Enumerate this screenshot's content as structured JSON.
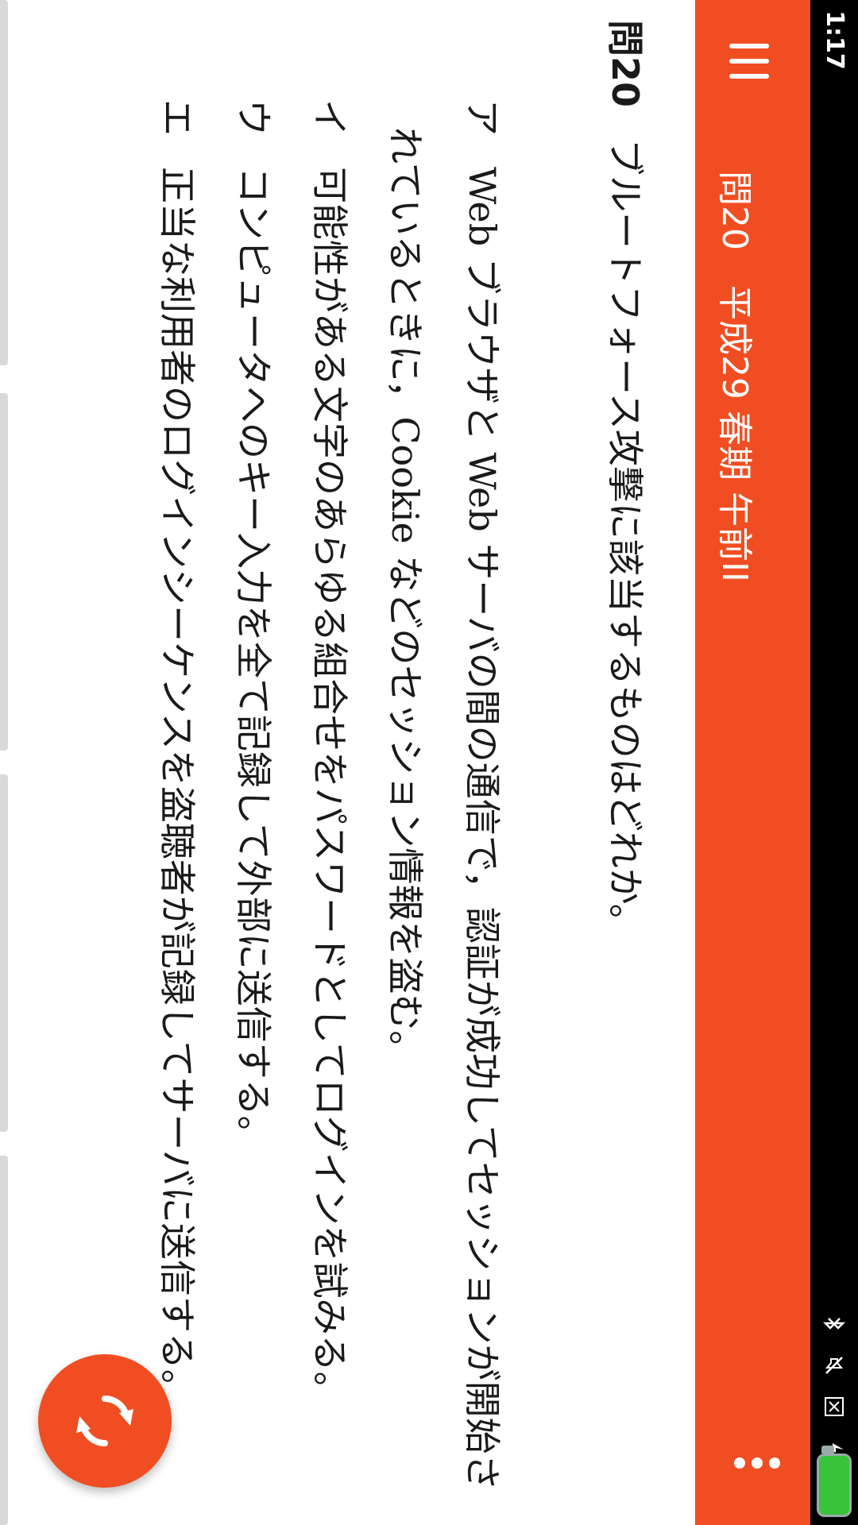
{
  "status_bar": {
    "time": "1:17",
    "icons": [
      "bluetooth-icon",
      "mute-icon",
      "close-box-icon",
      "charging-icon"
    ],
    "battery_color": "#39c33a"
  },
  "app_bar": {
    "title": "問20　平成29 春期 午前II",
    "background": "#f04e22"
  },
  "question": {
    "number": "問20",
    "text": "ブルートフォース攻撃に該当するものはどれか。",
    "options": [
      {
        "label": "ア",
        "lines": [
          "Web ブラウザと Web サーバの間の通信で，認証が成功してセッションが開始さ",
          "れているときに，Cookie などのセッション情報を盗む。"
        ]
      },
      {
        "label": "イ",
        "lines": [
          "可能性がある文字のあらゆる組合せをパスワードとしてログインを試みる。"
        ]
      },
      {
        "label": "ウ",
        "lines": [
          "コンピュータへのキー入力を全て記録して外部に送信する。"
        ]
      },
      {
        "label": "エ",
        "lines": [
          "正当な利用者のログインシーケンスを盗聴者が記録してサーバに送信する。"
        ]
      }
    ]
  },
  "fab": {
    "icon": "refresh-icon",
    "color": "#f04e22"
  }
}
